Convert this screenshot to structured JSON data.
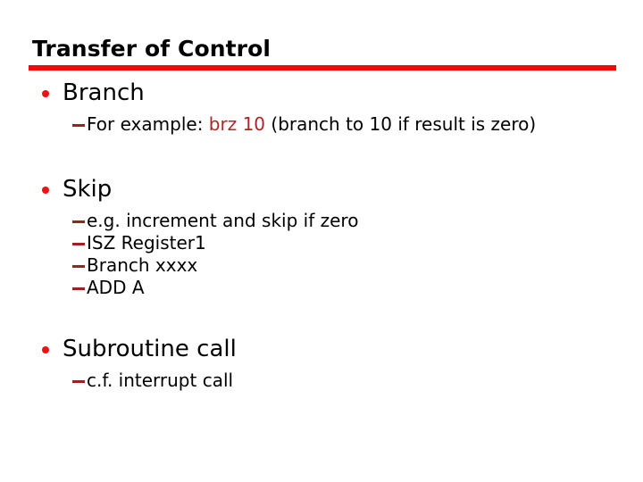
{
  "slide": {
    "title": "Transfer of Control",
    "accent_color": "#f20a0a",
    "bullet_color": "#ee1111",
    "dash_color": "#9e2222",
    "code_color": "#b02525",
    "text_color": "#000000",
    "background_color": "#ffffff"
  },
  "sections": [
    {
      "heading": "Branch",
      "sub": [
        {
          "prefix": "For example: ",
          "code": "brz 10",
          "suffix": " (branch to 10 if result is zero)"
        }
      ]
    },
    {
      "heading": "Skip",
      "sub": [
        {
          "text": "e.g. increment and skip if zero"
        },
        {
          "text": "ISZ Register1"
        },
        {
          "text": "Branch xxxx"
        },
        {
          "text": "ADD A"
        }
      ]
    },
    {
      "heading": "Subroutine call",
      "sub": [
        {
          "text": "c.f. interrupt call"
        }
      ]
    }
  ]
}
